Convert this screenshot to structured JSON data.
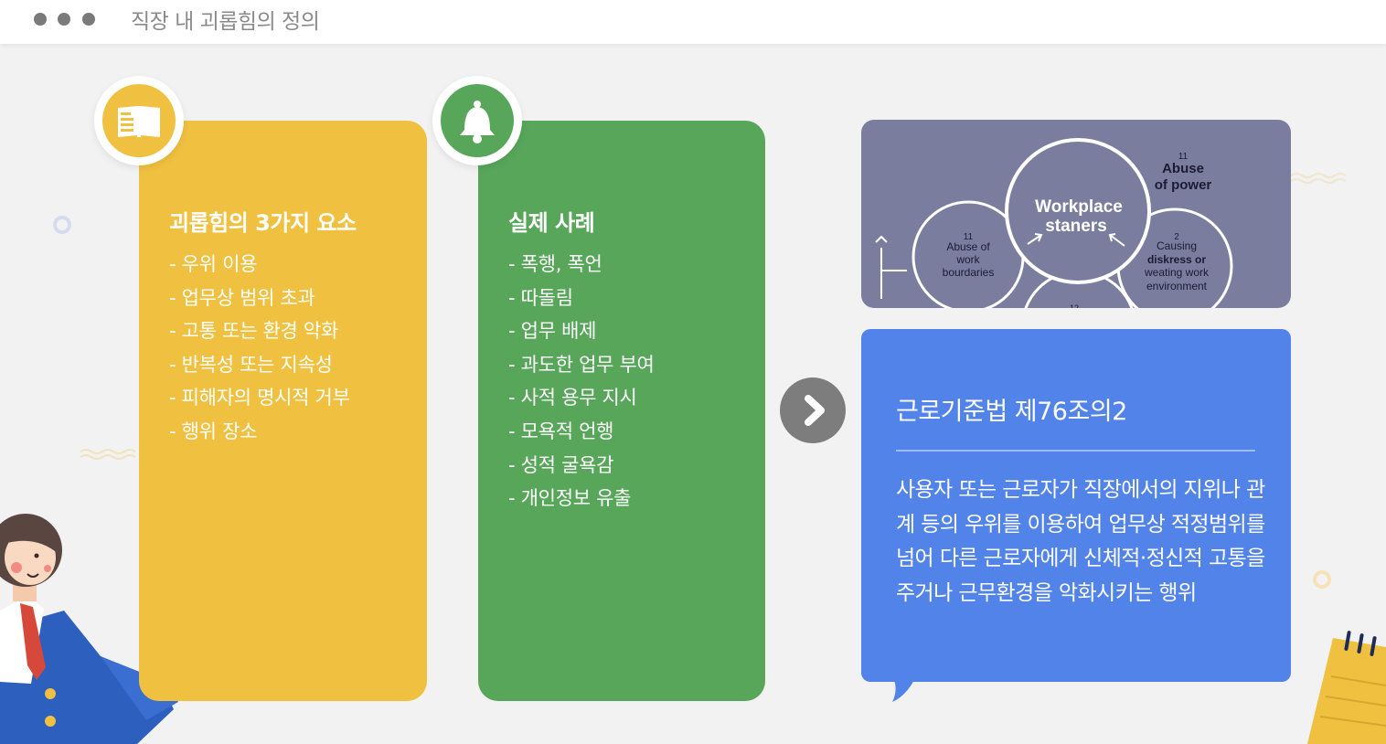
{
  "header": {
    "title": "직장 내 괴롭힘의 정의"
  },
  "card_elements": {
    "title": "괴롭힘의 3가지 요소",
    "items": [
      "- 우위 이용",
      "- 업무상 범위 초과",
      "- 고통 또는 환경 악화",
      "- 반복성 또는 지속성",
      "- 피해자의 명시적 거부",
      "- 행위 장소"
    ],
    "icon": "book-icon",
    "color": "#f0c040"
  },
  "card_cases": {
    "title": "실제 사례",
    "items": [
      "- 폭행, 폭언",
      "- 따돌림",
      "- 업무 배제",
      "- 과도한 업무 부여",
      "- 사적 용무 지시",
      "- 모욕적 언행",
      "- 성적 굴욕감",
      "- 개인정보 유출"
    ],
    "icon": "bell-icon",
    "color": "#57a65a"
  },
  "diagram_image": {
    "center": [
      "Workplace",
      "staners"
    ],
    "top_right": {
      "num": "11",
      "lines": [
        "Abuse",
        "of power"
      ]
    },
    "left": {
      "num": "11",
      "lines": [
        "Abuse of",
        "work",
        "bourdaries"
      ]
    },
    "right": {
      "num": "2",
      "lines": [
        "Causing",
        "diskress or",
        "weating work",
        "environment"
      ]
    },
    "bottom_num": "12"
  },
  "law": {
    "title": "근로기준법 제76조의2",
    "body": "사용자 또는 근로자가 직장에서의 지위나 관계 등의 우위를 이용하여 업무상 적정범위를 넘어 다른 근로자에게 신체적·정신적 고통을 주거나 근무환경을 악화시키는 행위",
    "color": "#5183e8"
  },
  "navigation": {
    "next_icon": "chevron-right-icon"
  }
}
